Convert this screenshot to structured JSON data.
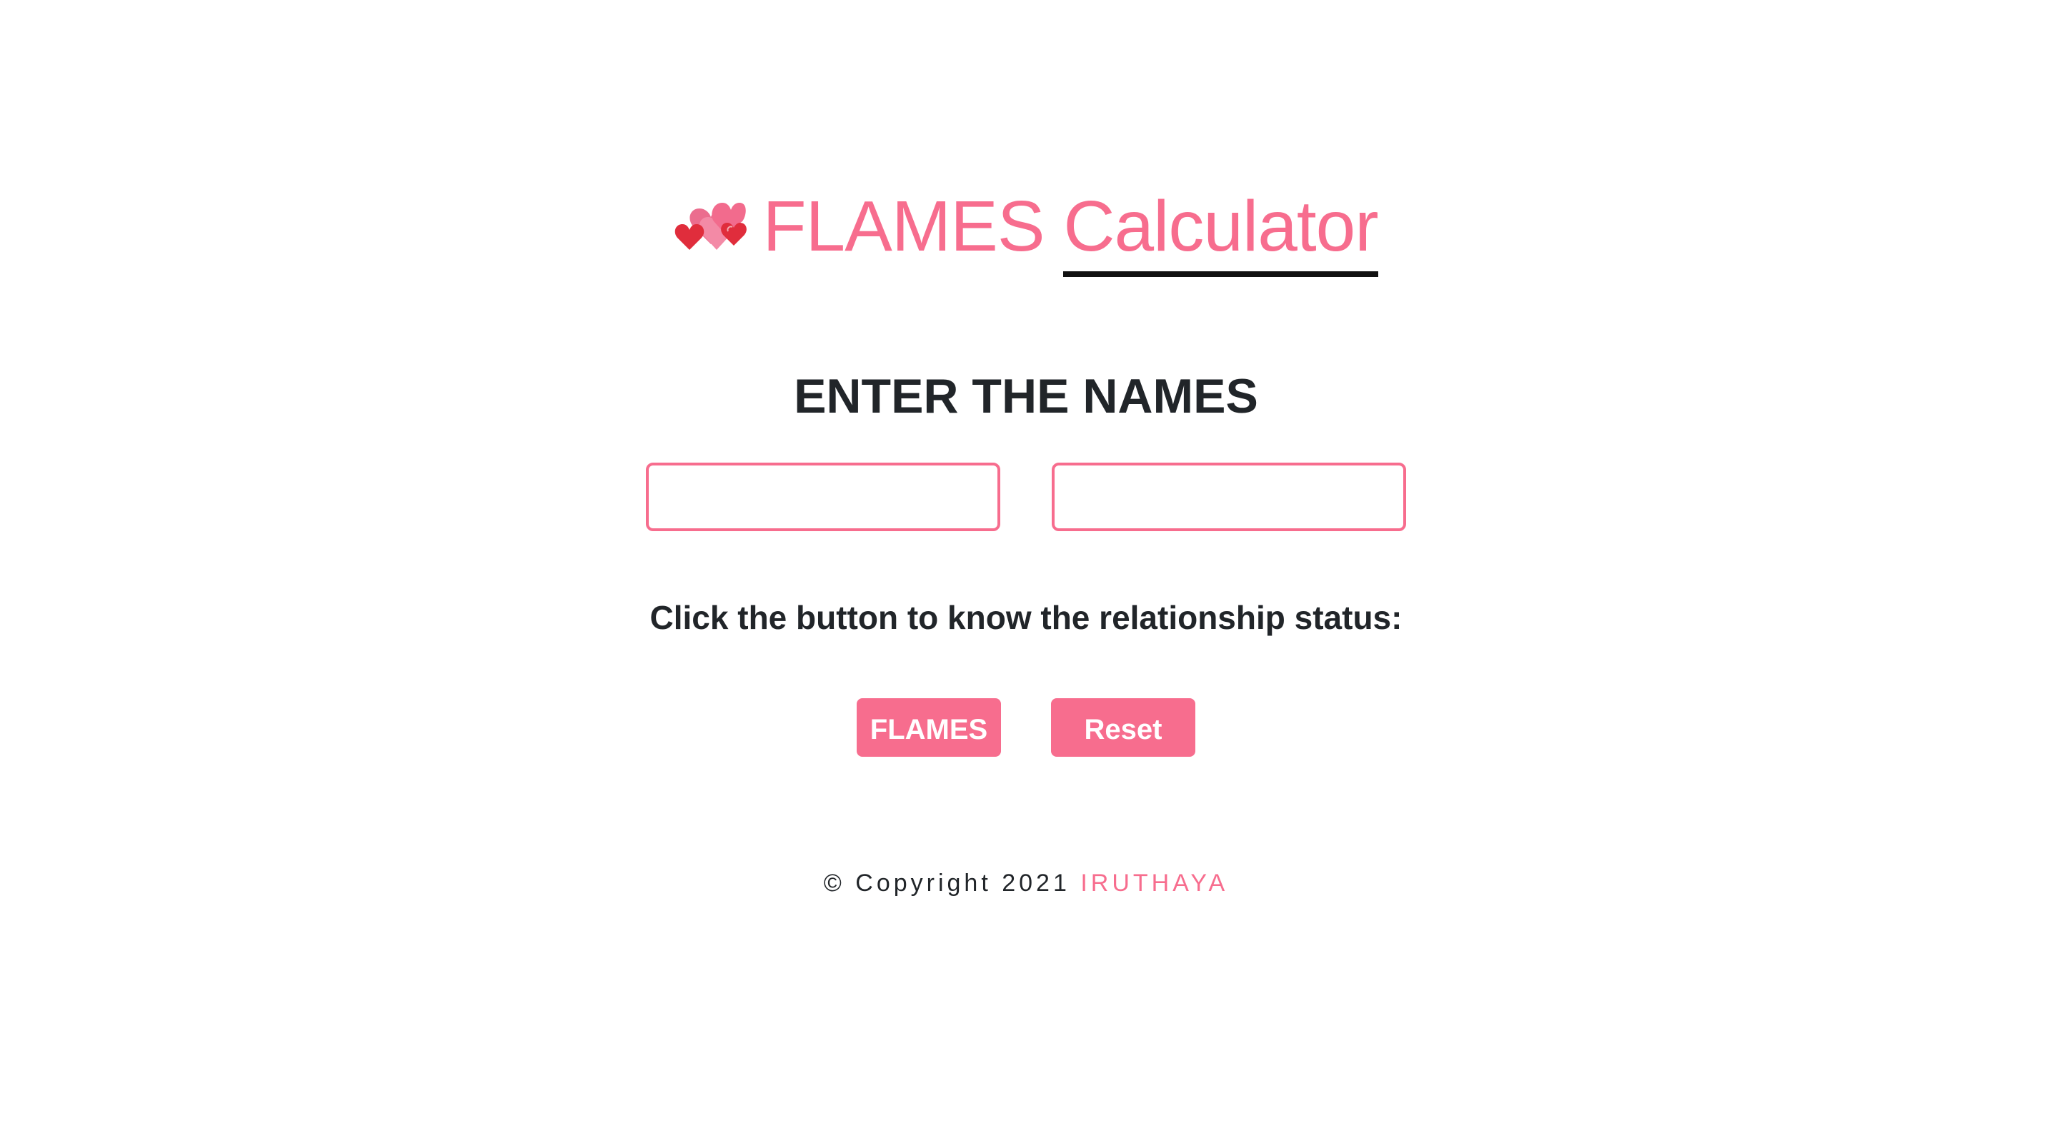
{
  "header": {
    "icon": "hearts-icon",
    "title_part1": "FLAMES ",
    "title_part2": "Calculator"
  },
  "form": {
    "heading": "ENTER THE NAMES",
    "name1": {
      "value": "",
      "placeholder": ""
    },
    "name2": {
      "value": "",
      "placeholder": ""
    },
    "instruction": "Click the button to know the relationship status:"
  },
  "buttons": {
    "flames_label": "FLAMES",
    "reset_label": "Reset"
  },
  "footer": {
    "copyright": "© Copyright 2021 ",
    "author": "IRUTHAYA"
  },
  "colors": {
    "accent": "#f76d8e",
    "text": "#212529",
    "underline": "#111111",
    "background": "#ffffff"
  }
}
